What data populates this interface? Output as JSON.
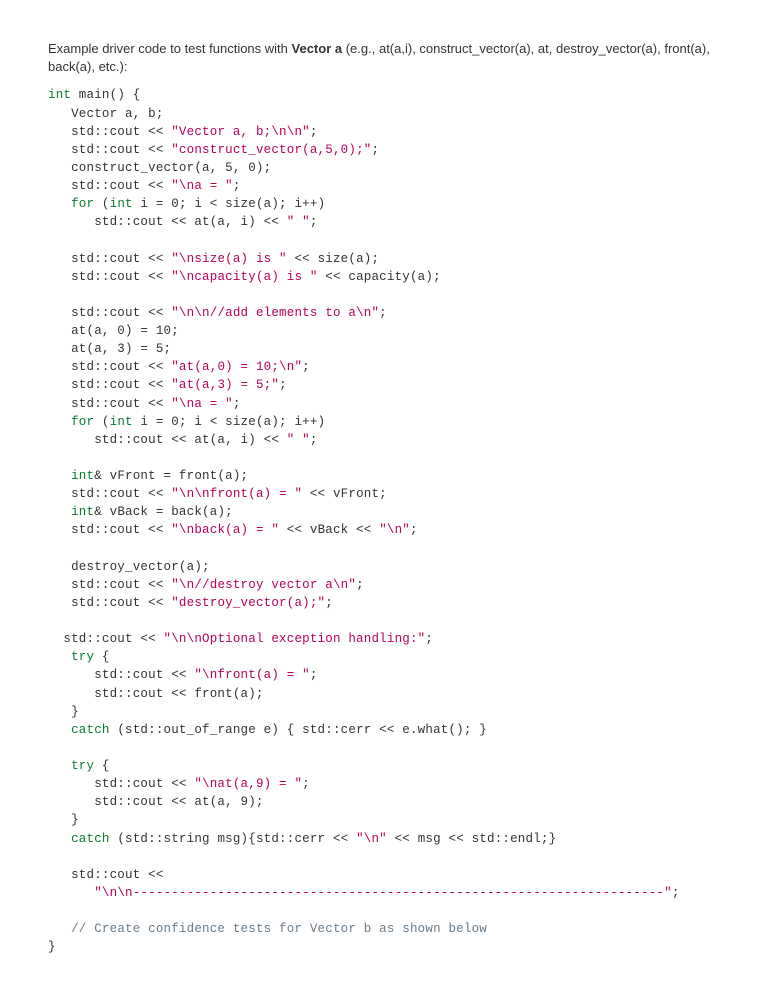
{
  "intro": {
    "prefix": "Example driver code to test functions with ",
    "bold": "Vector a",
    "suffix": " (e.g., at(a,i), construct_vector(a), at, destroy_vector(a), front(a), back(a), etc.):"
  },
  "code": {
    "lines": [
      {
        "segs": [
          {
            "t": "int",
            "c": "kw"
          },
          {
            "t": " main() {"
          }
        ]
      },
      {
        "segs": [
          {
            "t": "   Vector a, b;"
          }
        ]
      },
      {
        "segs": [
          {
            "t": "   std::cout << "
          },
          {
            "t": "\"Vector a, b;\\n\\n\"",
            "c": "str"
          },
          {
            "t": ";"
          }
        ]
      },
      {
        "segs": [
          {
            "t": "   std::cout << "
          },
          {
            "t": "\"construct_vector(a,5,0);\"",
            "c": "str"
          },
          {
            "t": ";"
          }
        ]
      },
      {
        "segs": [
          {
            "t": "   construct_vector(a, 5, 0);"
          }
        ]
      },
      {
        "segs": [
          {
            "t": "   std::cout << "
          },
          {
            "t": "\"\\na = \"",
            "c": "str"
          },
          {
            "t": ";"
          }
        ]
      },
      {
        "segs": [
          {
            "t": "   "
          },
          {
            "t": "for",
            "c": "kw"
          },
          {
            "t": " ("
          },
          {
            "t": "int",
            "c": "kw"
          },
          {
            "t": " i = 0; i < size(a); i++)"
          }
        ]
      },
      {
        "segs": [
          {
            "t": "      std::cout << at(a, i) << "
          },
          {
            "t": "\" \"",
            "c": "str"
          },
          {
            "t": ";"
          }
        ]
      },
      {
        "segs": [
          {
            "t": ""
          }
        ]
      },
      {
        "segs": [
          {
            "t": "   std::cout << "
          },
          {
            "t": "\"\\nsize(a) is \"",
            "c": "str"
          },
          {
            "t": " << size(a);"
          }
        ]
      },
      {
        "segs": [
          {
            "t": "   std::cout << "
          },
          {
            "t": "\"\\ncapacity(a) is \"",
            "c": "str"
          },
          {
            "t": " << capacity(a);"
          }
        ]
      },
      {
        "segs": [
          {
            "t": ""
          }
        ]
      },
      {
        "segs": [
          {
            "t": "   std::cout << "
          },
          {
            "t": "\"\\n\\n//add elements to a\\n\"",
            "c": "str"
          },
          {
            "t": ";"
          }
        ]
      },
      {
        "segs": [
          {
            "t": "   at(a, 0) = 10;"
          }
        ]
      },
      {
        "segs": [
          {
            "t": "   at(a, 3) = 5;"
          }
        ]
      },
      {
        "segs": [
          {
            "t": "   std::cout << "
          },
          {
            "t": "\"at(a,0) = 10;\\n\"",
            "c": "str"
          },
          {
            "t": ";"
          }
        ]
      },
      {
        "segs": [
          {
            "t": "   std::cout << "
          },
          {
            "t": "\"at(a,3) = 5;\"",
            "c": "str"
          },
          {
            "t": ";"
          }
        ]
      },
      {
        "segs": [
          {
            "t": "   std::cout << "
          },
          {
            "t": "\"\\na = \"",
            "c": "str"
          },
          {
            "t": ";"
          }
        ]
      },
      {
        "segs": [
          {
            "t": "   "
          },
          {
            "t": "for",
            "c": "kw"
          },
          {
            "t": " ("
          },
          {
            "t": "int",
            "c": "kw"
          },
          {
            "t": " i = 0; i < size(a); i++)"
          }
        ]
      },
      {
        "segs": [
          {
            "t": "      std::cout << at(a, i) << "
          },
          {
            "t": "\" \"",
            "c": "str"
          },
          {
            "t": ";"
          }
        ]
      },
      {
        "segs": [
          {
            "t": ""
          }
        ]
      },
      {
        "segs": [
          {
            "t": "   "
          },
          {
            "t": "int",
            "c": "kw"
          },
          {
            "t": "& vFront = front(a);"
          }
        ]
      },
      {
        "segs": [
          {
            "t": "   std::cout << "
          },
          {
            "t": "\"\\n\\nfront(a) = \"",
            "c": "str"
          },
          {
            "t": " << vFront;"
          }
        ]
      },
      {
        "segs": [
          {
            "t": "   "
          },
          {
            "t": "int",
            "c": "kw"
          },
          {
            "t": "& vBack = back(a);"
          }
        ]
      },
      {
        "segs": [
          {
            "t": "   std::cout << "
          },
          {
            "t": "\"\\nback(a) = \"",
            "c": "str"
          },
          {
            "t": " << vBack << "
          },
          {
            "t": "\"\\n\"",
            "c": "str"
          },
          {
            "t": ";"
          }
        ]
      },
      {
        "segs": [
          {
            "t": ""
          }
        ]
      },
      {
        "segs": [
          {
            "t": "   destroy_vector(a);"
          }
        ]
      },
      {
        "segs": [
          {
            "t": "   std::cout << "
          },
          {
            "t": "\"\\n//destroy vector a\\n\"",
            "c": "str"
          },
          {
            "t": ";"
          }
        ]
      },
      {
        "segs": [
          {
            "t": "   std::cout << "
          },
          {
            "t": "\"destroy_vector(a);\"",
            "c": "str"
          },
          {
            "t": ";"
          }
        ]
      },
      {
        "segs": [
          {
            "t": ""
          }
        ]
      },
      {
        "segs": [
          {
            "t": "  std::cout << "
          },
          {
            "t": "\"\\n\\nOptional exception handling:\"",
            "c": "str"
          },
          {
            "t": ";"
          }
        ]
      },
      {
        "segs": [
          {
            "t": "   "
          },
          {
            "t": "try",
            "c": "kw"
          },
          {
            "t": " {"
          }
        ]
      },
      {
        "segs": [
          {
            "t": "      std::cout << "
          },
          {
            "t": "\"\\nfront(a) = \"",
            "c": "str"
          },
          {
            "t": ";"
          }
        ]
      },
      {
        "segs": [
          {
            "t": "      std::cout << front(a);"
          }
        ]
      },
      {
        "segs": [
          {
            "t": "   }"
          }
        ]
      },
      {
        "segs": [
          {
            "t": "   "
          },
          {
            "t": "catch",
            "c": "kw"
          },
          {
            "t": " (std::out_of_range e) { std::cerr << e.what(); }"
          }
        ]
      },
      {
        "segs": [
          {
            "t": ""
          }
        ]
      },
      {
        "segs": [
          {
            "t": "   "
          },
          {
            "t": "try",
            "c": "kw"
          },
          {
            "t": " {"
          }
        ]
      },
      {
        "segs": [
          {
            "t": "      std::cout << "
          },
          {
            "t": "\"\\nat(a,9) = \"",
            "c": "str"
          },
          {
            "t": ";"
          }
        ]
      },
      {
        "segs": [
          {
            "t": "      std::cout << at(a, 9);"
          }
        ]
      },
      {
        "segs": [
          {
            "t": "   }"
          }
        ]
      },
      {
        "segs": [
          {
            "t": "   "
          },
          {
            "t": "catch",
            "c": "kw"
          },
          {
            "t": " (std::string msg){std::cerr << "
          },
          {
            "t": "\"\\n\"",
            "c": "str"
          },
          {
            "t": " << msg << std::endl;}"
          }
        ]
      },
      {
        "segs": [
          {
            "t": ""
          }
        ]
      },
      {
        "segs": [
          {
            "t": "   std::cout <<"
          }
        ]
      },
      {
        "segs": [
          {
            "t": "      "
          },
          {
            "t": "\"\\n\\n---------------------------------------------------------------------\"",
            "c": "str"
          },
          {
            "t": ";"
          }
        ]
      },
      {
        "segs": [
          {
            "t": ""
          }
        ]
      },
      {
        "segs": [
          {
            "t": "   "
          },
          {
            "t": "// Create confidence tests for Vector b as shown below",
            "c": "cm"
          }
        ]
      },
      {
        "segs": [
          {
            "t": "}"
          }
        ]
      }
    ]
  }
}
